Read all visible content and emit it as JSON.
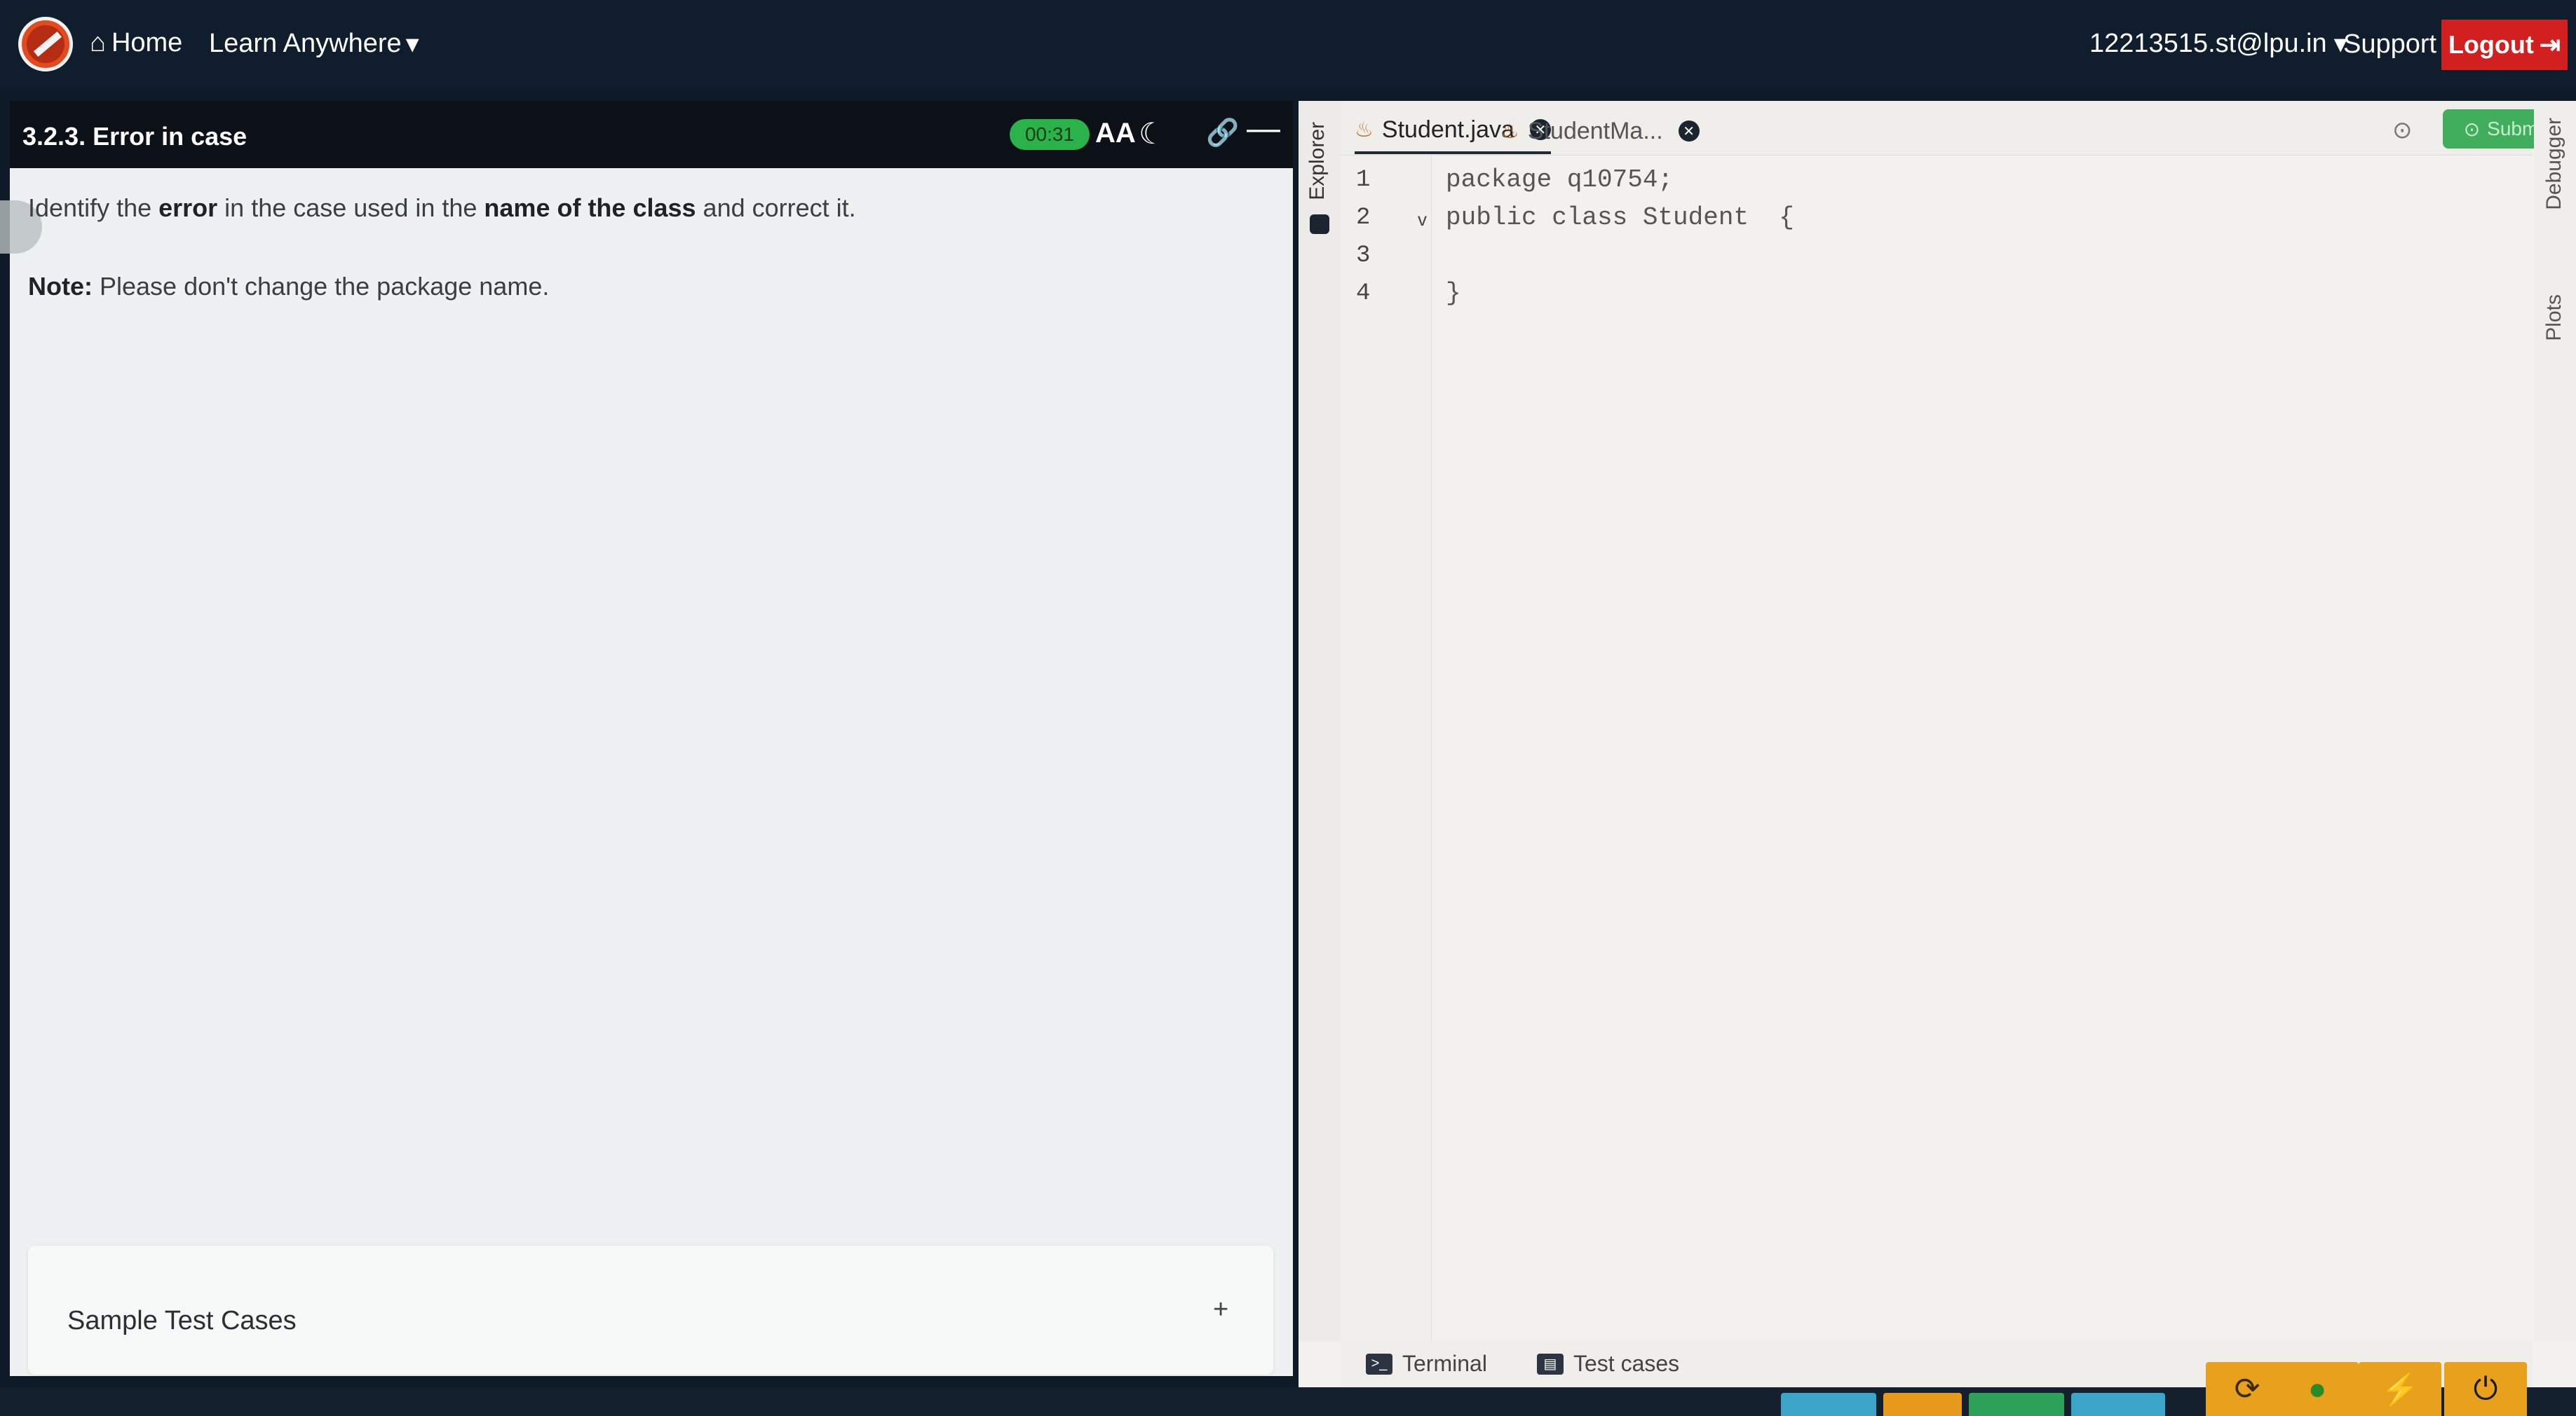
{
  "nav": {
    "home": "Home",
    "learn": "Learn Anywhere",
    "user": "12213515.st@lpu.in",
    "support": "Support",
    "logout": "Logout"
  },
  "question": {
    "title": "3.2.3. Error in case",
    "timer": "00:31",
    "font_label": "AA",
    "text_pre": "Identify the ",
    "text_b1": "error",
    "text_mid": " in the case used in the ",
    "text_b2": "name of the class",
    "text_post": " and correct it.",
    "note_label": "Note:",
    "note_text": " Please don't change the package name.",
    "sample_label": "Sample Test Cases",
    "sample_toggle": "+"
  },
  "editor": {
    "explorer_label": "Explorer",
    "tabs": [
      {
        "label": "Student.java"
      },
      {
        "label": "StudentMa..."
      }
    ],
    "submit_label": "Submit",
    "line_numbers": [
      "1",
      "2",
      "3",
      "4"
    ],
    "code_lines": [
      "package q10754;",
      "public class Student  {",
      "",
      "}"
    ],
    "debugger_label": "Debugger",
    "plots_label": "Plots",
    "terminal_label": "Terminal",
    "testcases_label": "Test cases"
  },
  "colors": {
    "topbar": "#0f1d2c",
    "logout": "#d21f1f",
    "timer": "#29b34a",
    "submit": "#22a344"
  }
}
